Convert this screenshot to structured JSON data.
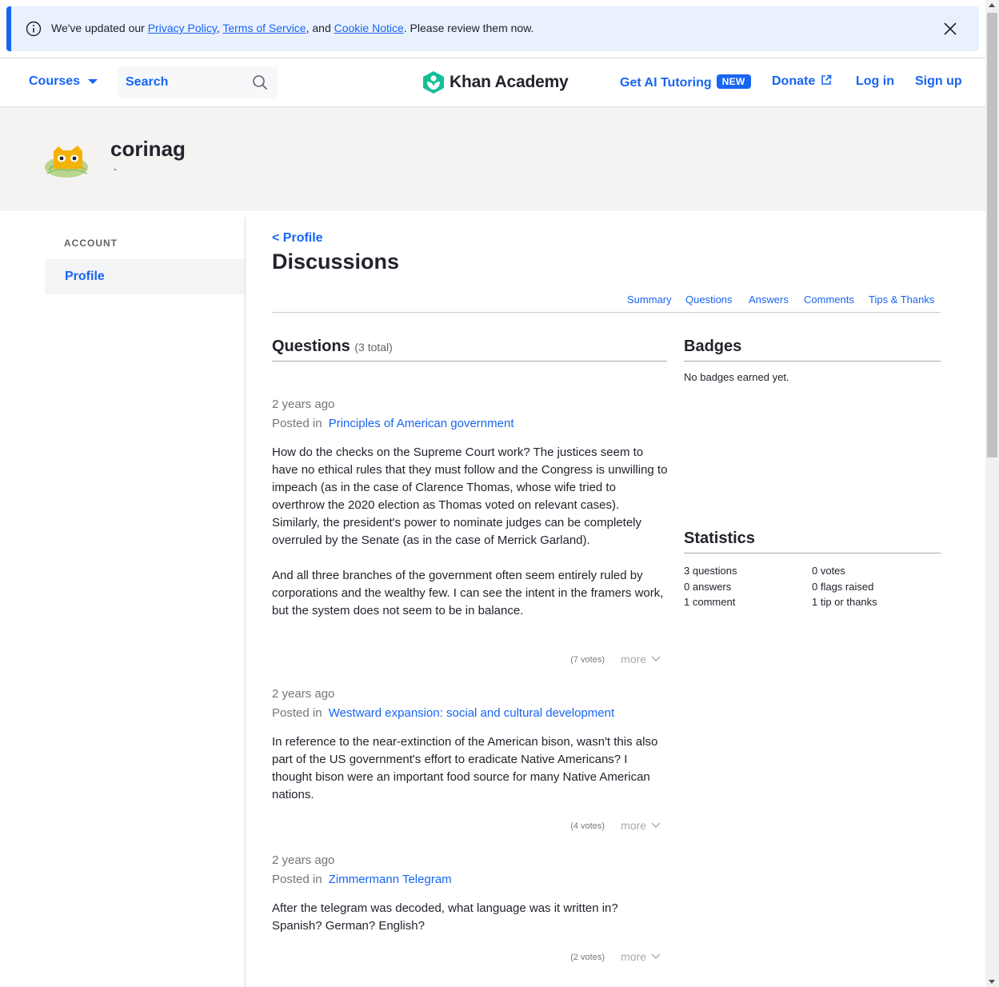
{
  "banner": {
    "prefix": "We've updated our ",
    "privacy": "Privacy Policy",
    "sep1": ", ",
    "terms": "Terms of Service",
    "sep2": ", and ",
    "cookie": "Cookie Notice",
    "suffix": ". Please review them now."
  },
  "header": {
    "courses": "Courses",
    "search_placeholder": "Search",
    "logo_text": "Khan Academy",
    "ai_tutoring": "Get AI Tutoring",
    "new_badge": "NEW",
    "donate": "Donate",
    "login": "Log in",
    "signup": "Sign up"
  },
  "profile": {
    "username": "corinag",
    "bio": "-"
  },
  "sidebar": {
    "section_label": "ACCOUNT",
    "items": [
      {
        "label": "Profile"
      }
    ]
  },
  "main": {
    "back_link": "< Profile",
    "title": "Discussions",
    "tabs": [
      "Summary",
      "Questions",
      "Answers",
      "Comments",
      "Tips & Thanks"
    ]
  },
  "questions": {
    "title": "Questions",
    "count": "(3 total)",
    "items": [
      {
        "time": "2 years ago",
        "posted_in_label": "Posted in",
        "topic": "Principles of American government",
        "body": [
          "How do the checks on the Supreme Court work? The justices seem to have no ethical rules that they must follow and the Congress is unwilling to impeach (as in the case of Clarence Thomas, whose wife tried to overthrow the 2020 election as Thomas voted on relevant cases). Similarly, the president's power to nominate judges can be completely overruled by the Senate (as in the case of Merrick Garland).",
          "And all three branches of the government often seem entirely ruled by corporations and the wealthy few. I can see the intent in the framers work, but the system does not seem to be in balance."
        ],
        "votes": "(7 votes)",
        "more": "more"
      },
      {
        "time": "2 years ago",
        "posted_in_label": "Posted in",
        "topic": "Westward expansion: social and cultural development",
        "body": [
          "In reference to the near-extinction of the American bison, wasn't this also part of the US government's effort to eradicate Native Americans? I thought bison were an important food source for many Native American nations."
        ],
        "votes": "(4 votes)",
        "more": "more"
      },
      {
        "time": "2 years ago",
        "posted_in_label": "Posted in",
        "topic": "Zimmermann Telegram",
        "body": [
          "After the telegram was decoded, what language was it written in? Spanish? German? English?"
        ],
        "votes": "(2 votes)",
        "more": "more"
      }
    ]
  },
  "badges": {
    "title": "Badges",
    "empty": "No badges earned yet."
  },
  "statistics": {
    "title": "Statistics",
    "left": [
      "3 questions",
      "0 answers",
      "1 comment"
    ],
    "right": [
      "0 votes",
      "0 flags raised",
      "1 tip or thanks"
    ]
  },
  "colors": {
    "accent": "#1865f2",
    "banner_bg": "#eaf1fe",
    "profile_band_bg": "#f4f3f1",
    "logo_green": "#14bf96"
  },
  "icons": [
    "info-icon",
    "close-icon",
    "caret-down-icon",
    "search-icon",
    "khan-logo-icon",
    "external-link-icon",
    "chevron-down-icon"
  ]
}
